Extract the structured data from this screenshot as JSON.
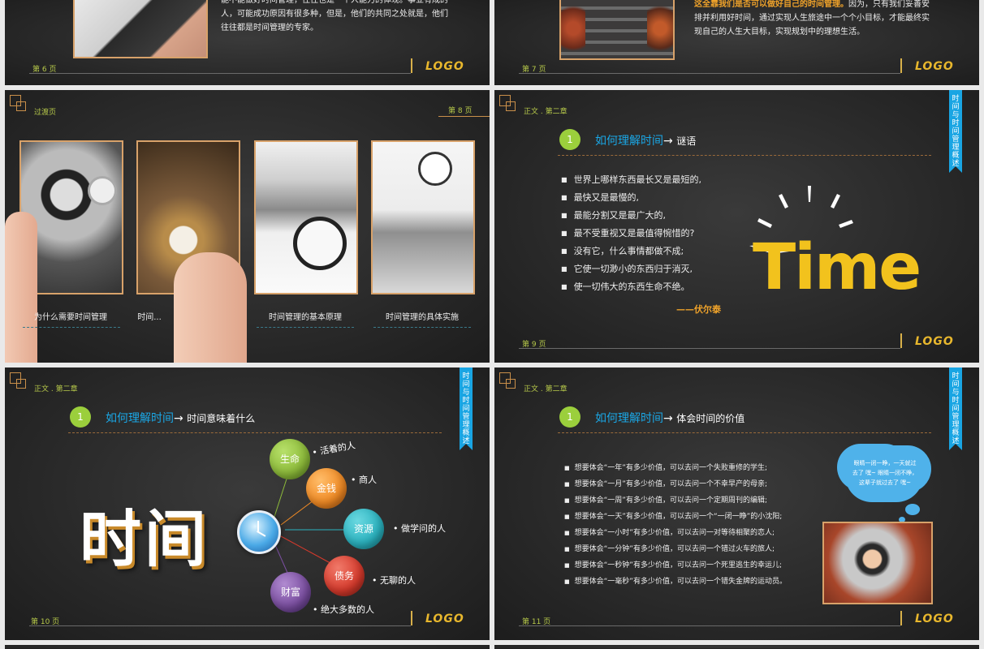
{
  "slide6": {
    "text": "能不能做好时间管理，往往也是一个人能力的体现。事业有成的人，可能成功原因有很多种，但是，他们的共同之处就是，他们往往都是时间管理的专家。",
    "page": "第 6 页",
    "logo": "LOGO"
  },
  "slide7": {
    "highlight": "这全靠我们是否可以做好自己的时间管理。",
    "text_after": "因为，只有我们妥善安排并利用好时间，通过实现人生旅途中一个个小目标，才能最终实现自己的人生大目标，实现规划中的理想生活。",
    "page": "第 7 页",
    "logo": "LOGO"
  },
  "slide8": {
    "crumb": "过渡页",
    "page": "第 8 页",
    "captions": [
      "为什么需要时间管理",
      "时间...",
      "时间管理的基本原理",
      "时间管理的具体实施"
    ]
  },
  "slide9": {
    "crumb": "正文 . 第二章",
    "tab": "时间与时间管理概述",
    "num": "1",
    "title": "如何理解时间",
    "arrow": "→",
    "subtitle": "谜语",
    "bullets": [
      "世界上哪样东西最长又是最短的,",
      "最快又是最慢的,",
      "最能分割又是最广大的,",
      "最不受重视又是最值得惋惜的?",
      "没有它，什么事情都做不成;",
      "它使一切渺小的东西归于消灭,",
      "使一切伟大的东西生命不绝。"
    ],
    "author": "——伏尔泰",
    "big_word": "Time",
    "page": "第 9 页",
    "logo": "LOGO"
  },
  "slide10": {
    "crumb": "正文 . 第二章",
    "tab": "时间与时间管理概述",
    "num": "1",
    "title": "如何理解时间",
    "arrow": "→",
    "subtitle": "时间意味着什么",
    "big_word": "时间",
    "bubbles": [
      {
        "label": "生命",
        "desc": "• 活着的人",
        "color": "#8dbb3a"
      },
      {
        "label": "金钱",
        "desc": "• 商人",
        "color": "#f08a24"
      },
      {
        "label": "资源",
        "desc": "• 做学问的人",
        "color": "#2bb3c0"
      },
      {
        "label": "债务",
        "desc": "• 无聊的人",
        "color": "#d63a2c"
      },
      {
        "label": "财富",
        "desc": "• 绝大多数的人",
        "color": "#7a4ea0"
      }
    ],
    "page": "第 10 页",
    "logo": "LOGO"
  },
  "slide11": {
    "crumb": "正文 . 第二章",
    "tab": "时间与时间管理概述",
    "num": "1",
    "title": "如何理解时间",
    "arrow": "→",
    "subtitle": "体会时间的价值",
    "bullets": [
      "想要体会“一年”有多少价值，可以去问一个失败重修的学生;",
      "想要体会“一月”有多少价值，可以去问一个不幸早产的母亲;",
      "想要体会“一周”有多少价值，可以去问一个定期周刊的编辑;",
      "想要体会“一天”有多少价值，可以去问一个“一闭一睁”的小沈阳;",
      "想要体会“一小时”有多少价值，可以去问一对等待相聚的恋人;",
      "想要体会“一分钟”有多少价值，可以去问一个错过火车的旅人;",
      "想要体会“一秒钟”有多少价值，可以去问一个死里逃生的幸运儿;",
      "想要体会“一毫秒”有多少价值，可以去问一个错失金牌的运动员。"
    ],
    "cloud_text": "眼睛一闭一睁，一天就过去了 嘿~ 眼睛一闭不睁，这辈子就过去了 嘿~",
    "page": "第 11 页",
    "logo": "LOGO"
  },
  "colors": {
    "accent_blue": "#1aa7e6",
    "accent_green": "#9bcf3c",
    "accent_orange": "#e8b72d",
    "tab_blue": "#19a5e3"
  }
}
